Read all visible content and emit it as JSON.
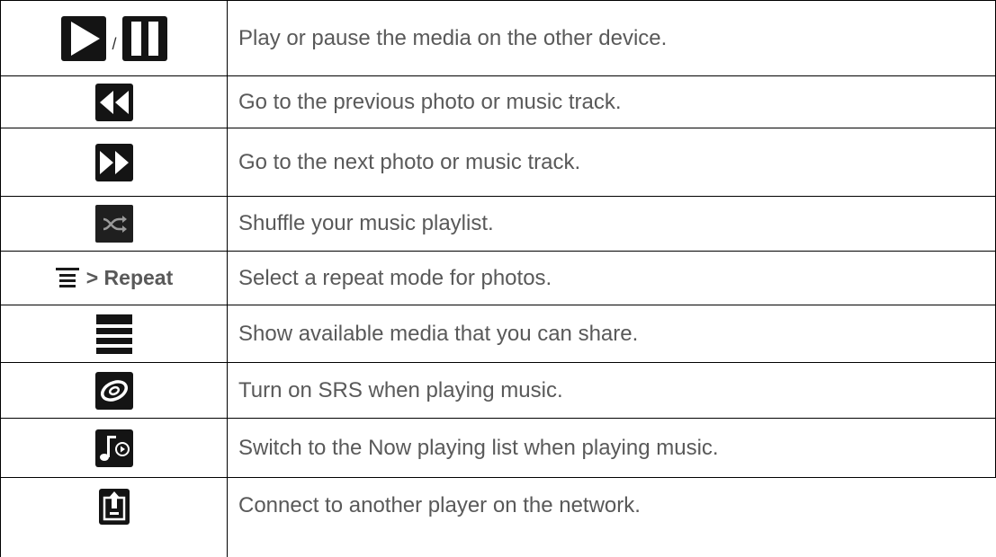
{
  "rows": [
    {
      "icon": "play-pause-icon",
      "separator": "/",
      "description": "Play or pause the media on the other device."
    },
    {
      "icon": "previous-icon",
      "description": "Go to the previous photo or music track."
    },
    {
      "icon": "next-icon",
      "description": "Go to the next photo or music track."
    },
    {
      "icon": "shuffle-icon",
      "description": "Shuffle your music playlist."
    },
    {
      "icon": "menu-icon",
      "icon_suffix": "> Repeat",
      "description": "Select a repeat mode for photos."
    },
    {
      "icon": "list-icon",
      "description": "Show available media that you can share."
    },
    {
      "icon": "srs-icon",
      "description": "Turn on SRS when playing music."
    },
    {
      "icon": "now-playing-icon",
      "description": "Switch to the Now playing list when playing music."
    },
    {
      "icon": "connect-player-icon",
      "description": "Connect to another player on the network."
    }
  ]
}
